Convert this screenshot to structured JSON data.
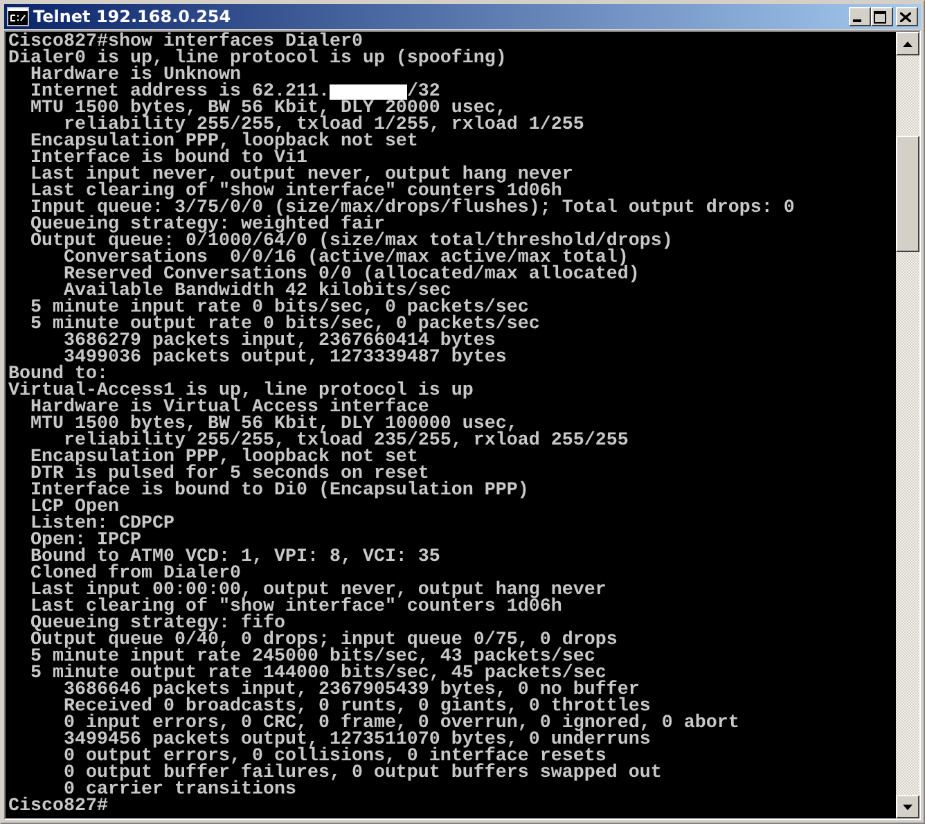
{
  "window": {
    "title": "Telnet 192.168.0.254"
  },
  "console": {
    "lines": [
      "Cisco827#show interfaces Dialer0",
      "Dialer0 is up, line protocol is up (spoofing)",
      "  Hardware is Unknown",
      {
        "kind": "redacted",
        "before": "  Internet address is 62.211.",
        "after": "/32"
      },
      "  MTU 1500 bytes, BW 56 Kbit, DLY 20000 usec,",
      "     reliability 255/255, txload 1/255, rxload 1/255",
      "  Encapsulation PPP, loopback not set",
      "  Interface is bound to Vi1",
      "  Last input never, output never, output hang never",
      "  Last clearing of \"show interface\" counters 1d06h",
      "  Input queue: 3/75/0/0 (size/max/drops/flushes); Total output drops: 0",
      "  Queueing strategy: weighted fair",
      "  Output queue: 0/1000/64/0 (size/max total/threshold/drops)",
      "     Conversations  0/0/16 (active/max active/max total)",
      "     Reserved Conversations 0/0 (allocated/max allocated)",
      "     Available Bandwidth 42 kilobits/sec",
      "  5 minute input rate 0 bits/sec, 0 packets/sec",
      "  5 minute output rate 0 bits/sec, 0 packets/sec",
      "     3686279 packets input, 2367660414 bytes",
      "     3499036 packets output, 1273339487 bytes",
      "Bound to:",
      "Virtual-Access1 is up, line protocol is up",
      "  Hardware is Virtual Access interface",
      "  MTU 1500 bytes, BW 56 Kbit, DLY 100000 usec,",
      "     reliability 255/255, txload 235/255, rxload 255/255",
      "  Encapsulation PPP, loopback not set",
      "  DTR is pulsed for 5 seconds on reset",
      "  Interface is bound to Di0 (Encapsulation PPP)",
      "  LCP Open",
      "  Listen: CDPCP",
      "  Open: IPCP",
      "  Bound to ATM0 VCD: 1, VPI: 8, VCI: 35",
      "  Cloned from Dialer0",
      "  Last input 00:00:00, output never, output hang never",
      "  Last clearing of \"show interface\" counters 1d06h",
      "  Queueing strategy: fifo",
      "  Output queue 0/40, 0 drops; input queue 0/75, 0 drops",
      "  5 minute input rate 245000 bits/sec, 43 packets/sec",
      "  5 minute output rate 144000 bits/sec, 45 packets/sec",
      "     3686646 packets input, 2367905439 bytes, 0 no buffer",
      "     Received 0 broadcasts, 0 runts, 0 giants, 0 throttles",
      "     0 input errors, 0 CRC, 0 frame, 0 overrun, 0 ignored, 0 abort",
      "     3499456 packets output, 1273511070 bytes, 0 underruns",
      "     0 output errors, 0 collisions, 0 interface resets",
      "     0 output buffer failures, 0 output buffers swapped out",
      "     0 carrier transitions",
      "Cisco827#"
    ]
  }
}
